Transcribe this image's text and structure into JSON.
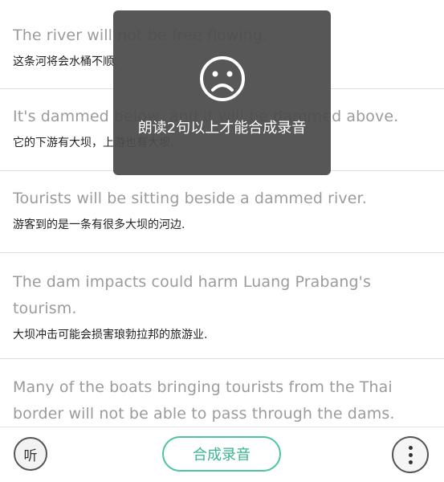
{
  "sentences": [
    {
      "en": "The river will not be free flowing.",
      "zh": "这条河将会水桶不顺."
    },
    {
      "en": "It's dammed below, and it will be dammed above.",
      "zh": "它的下游有大坝，上游也有大坝."
    },
    {
      "en": "Tourists will be sitting beside a dammed river.",
      "zh": "游客到的是一条有很多大坝的河边."
    },
    {
      "en": "The dam impacts could harm Luang Prabang's tourism.",
      "zh": "大坝冲击可能会损害琅勃拉邦的旅游业."
    },
    {
      "en": "Many of the boats bringing tourists from the Thai border will not be able to pass through the dams.",
      "zh": ""
    }
  ],
  "toast": {
    "message": "朗读2句以上才能合成录音",
    "icon": "sad-face-icon"
  },
  "bottom_bar": {
    "listen_label": "听",
    "synthesize_label": "合成录音",
    "more_icon": "more-vertical-icon"
  },
  "colors": {
    "accent": "#4cc3a3",
    "toast_bg": "#4c4c4c",
    "english_text": "#9b9b9b"
  }
}
